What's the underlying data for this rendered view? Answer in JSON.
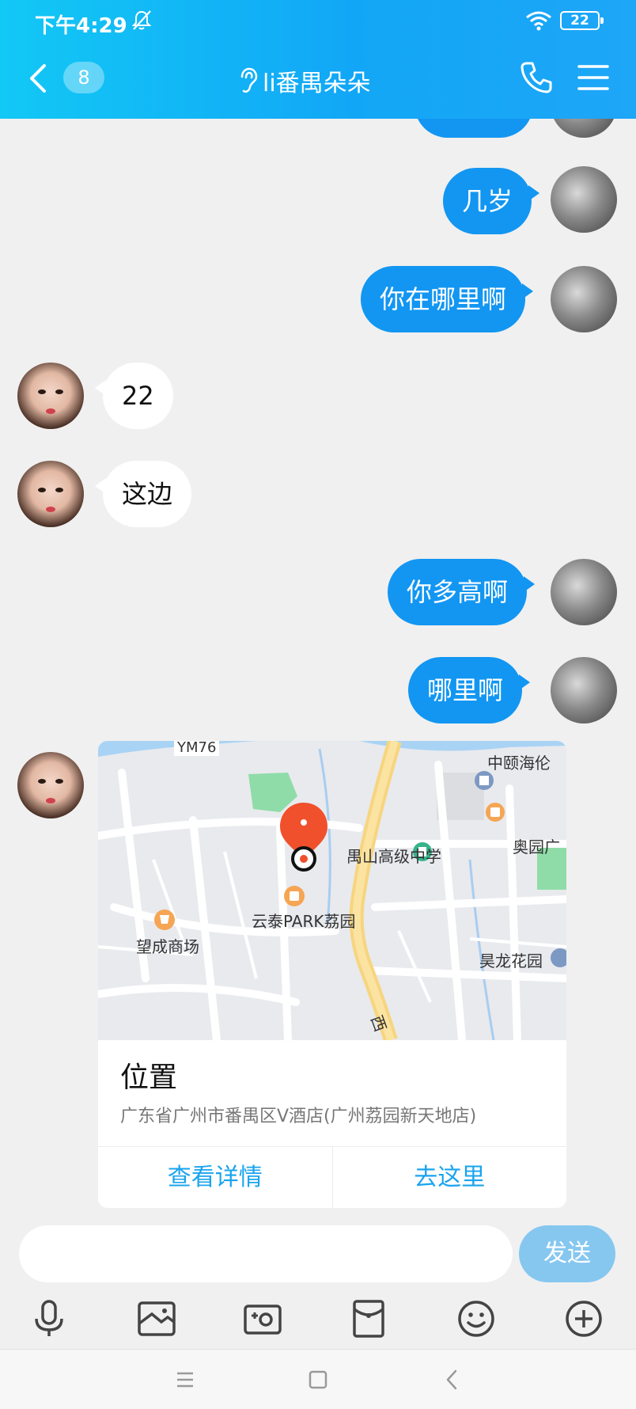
{
  "status_bar": {
    "time": "下午4:29",
    "battery": "22"
  },
  "header": {
    "unread_count": "8",
    "title": "li番禺朵朵"
  },
  "messages": [
    {
      "side": "me",
      "text": "几岁"
    },
    {
      "side": "me",
      "text": "你在哪里啊"
    },
    {
      "side": "her",
      "text": "22"
    },
    {
      "side": "her",
      "text": "这边"
    },
    {
      "side": "me",
      "text": "你多高啊"
    },
    {
      "side": "me",
      "text": "哪里啊"
    }
  ],
  "location_card": {
    "map_labels": {
      "road_code": "YM76",
      "poi_1": "中颐海伦",
      "poi_2": "奥园广",
      "school": "禺山高级中学",
      "park": "云泰PARK荔园",
      "mall": "望成商场",
      "garden": "昊龙花园",
      "road": "西"
    },
    "title": "位置",
    "address": "广东省广州市番禺区V酒店(广州荔园新天地店)",
    "details_label": "查看详情",
    "go_label": "去这里"
  },
  "input": {
    "placeholder": "",
    "value": "",
    "send_label": "发送"
  },
  "toolbar_icons": [
    "microphone-icon",
    "picture-icon",
    "camera-icon",
    "red-packet-icon",
    "emoji-icon",
    "plus-icon"
  ],
  "colors": {
    "header_start": "#12c8f5",
    "header_end": "#1ea6f7",
    "my_bubble": "#1296f2",
    "link": "#1aa4ee",
    "send_disabled": "#86c7f0",
    "map_pin": "#f0502b"
  }
}
